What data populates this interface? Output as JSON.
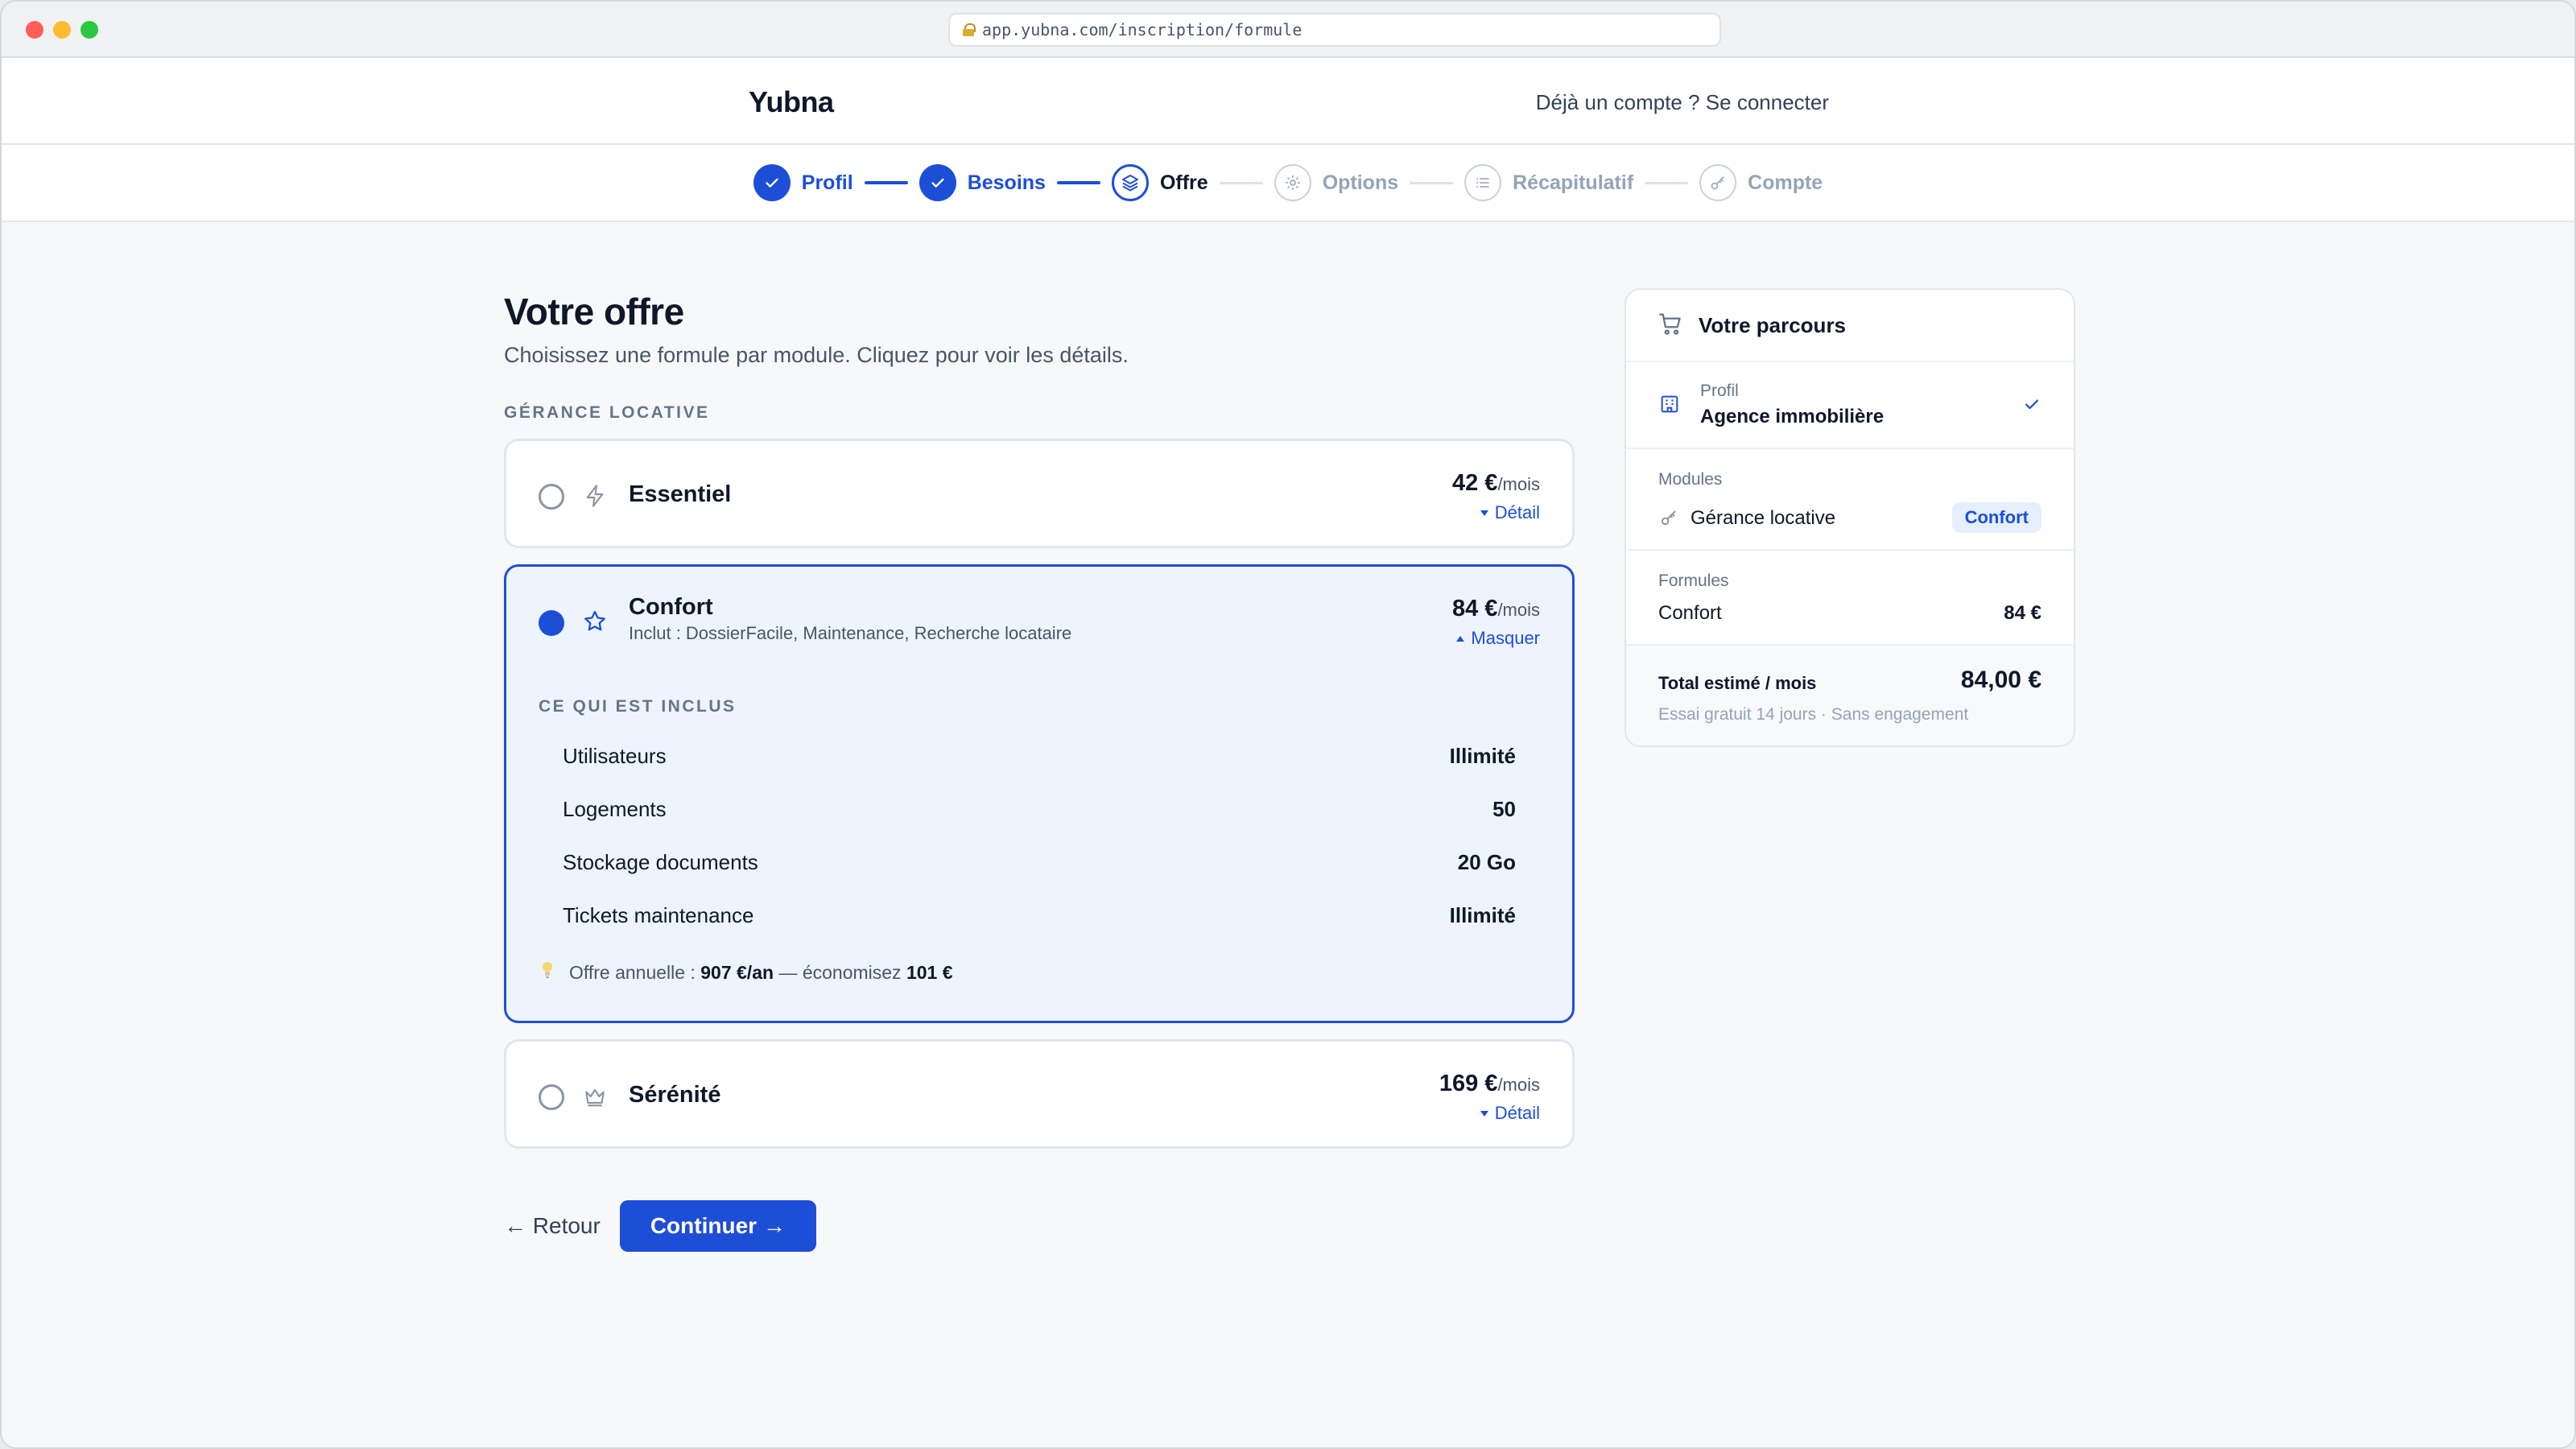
{
  "browser": {
    "url": "app.yubna.com/inscription/formule"
  },
  "header": {
    "brand": "Yubna",
    "login_link": "Déjà un compte ? Se connecter"
  },
  "stepper": {
    "steps": [
      {
        "label": "Profil",
        "state": "done",
        "icon": "check-icon"
      },
      {
        "label": "Besoins",
        "state": "done",
        "icon": "check-icon"
      },
      {
        "label": "Offre",
        "state": "current",
        "icon": "layers-icon"
      },
      {
        "label": "Options",
        "state": "todo",
        "icon": "gear-icon"
      },
      {
        "label": "Récapitulatif",
        "state": "todo",
        "icon": "list-icon"
      },
      {
        "label": "Compte",
        "state": "todo",
        "icon": "key-icon"
      }
    ]
  },
  "page": {
    "title": "Votre offre",
    "subtitle": "Choisissez une formule par module. Cliquez pour voir les détails.",
    "section_label": "GÉRANCE LOCATIVE"
  },
  "plans": [
    {
      "name": "Essentiel",
      "price": "42 €",
      "per": "/mois",
      "toggle": "Détail",
      "icon": "bolt-icon",
      "selected": false
    },
    {
      "name": "Confort",
      "price": "84 €",
      "per": "/mois",
      "toggle": "Masquer",
      "icon": "star-icon",
      "selected": true,
      "includes": "Inclut : DossierFacile, Maintenance, Recherche locataire",
      "included_label": "CE QUI EST INCLUS",
      "features": [
        {
          "label": "Utilisateurs",
          "value": "Illimité"
        },
        {
          "label": "Logements",
          "value": "50"
        },
        {
          "label": "Stockage documents",
          "value": "20 Go"
        },
        {
          "label": "Tickets maintenance",
          "value": "Illimité"
        }
      ],
      "annual": {
        "prefix": "Offre annuelle :",
        "price": "907 €/an",
        "middle": "— économisez",
        "saving": "101 €"
      }
    },
    {
      "name": "Sérénité",
      "price": "169 €",
      "per": "/mois",
      "toggle": "Détail",
      "icon": "crown-icon",
      "selected": false
    }
  ],
  "actions": {
    "back": "← Retour",
    "continue": "Continuer →"
  },
  "sidebar": {
    "title": "Votre parcours",
    "profile_label": "Profil",
    "profile_value": "Agence immobilière",
    "modules_label": "Modules",
    "module_name": "Gérance locative",
    "module_badge": "Confort",
    "formulas_label": "Formules",
    "formula_name": "Confort",
    "formula_price": "84 €",
    "total_label": "Total estimé / mois",
    "total_value": "84,00 €",
    "total_note": "Essai gratuit 14 jours · Sans engagement"
  },
  "colors": {
    "accent": "#1d4ed8",
    "selected_bg": "#eef4fe",
    "muted": "#94a3b8"
  }
}
